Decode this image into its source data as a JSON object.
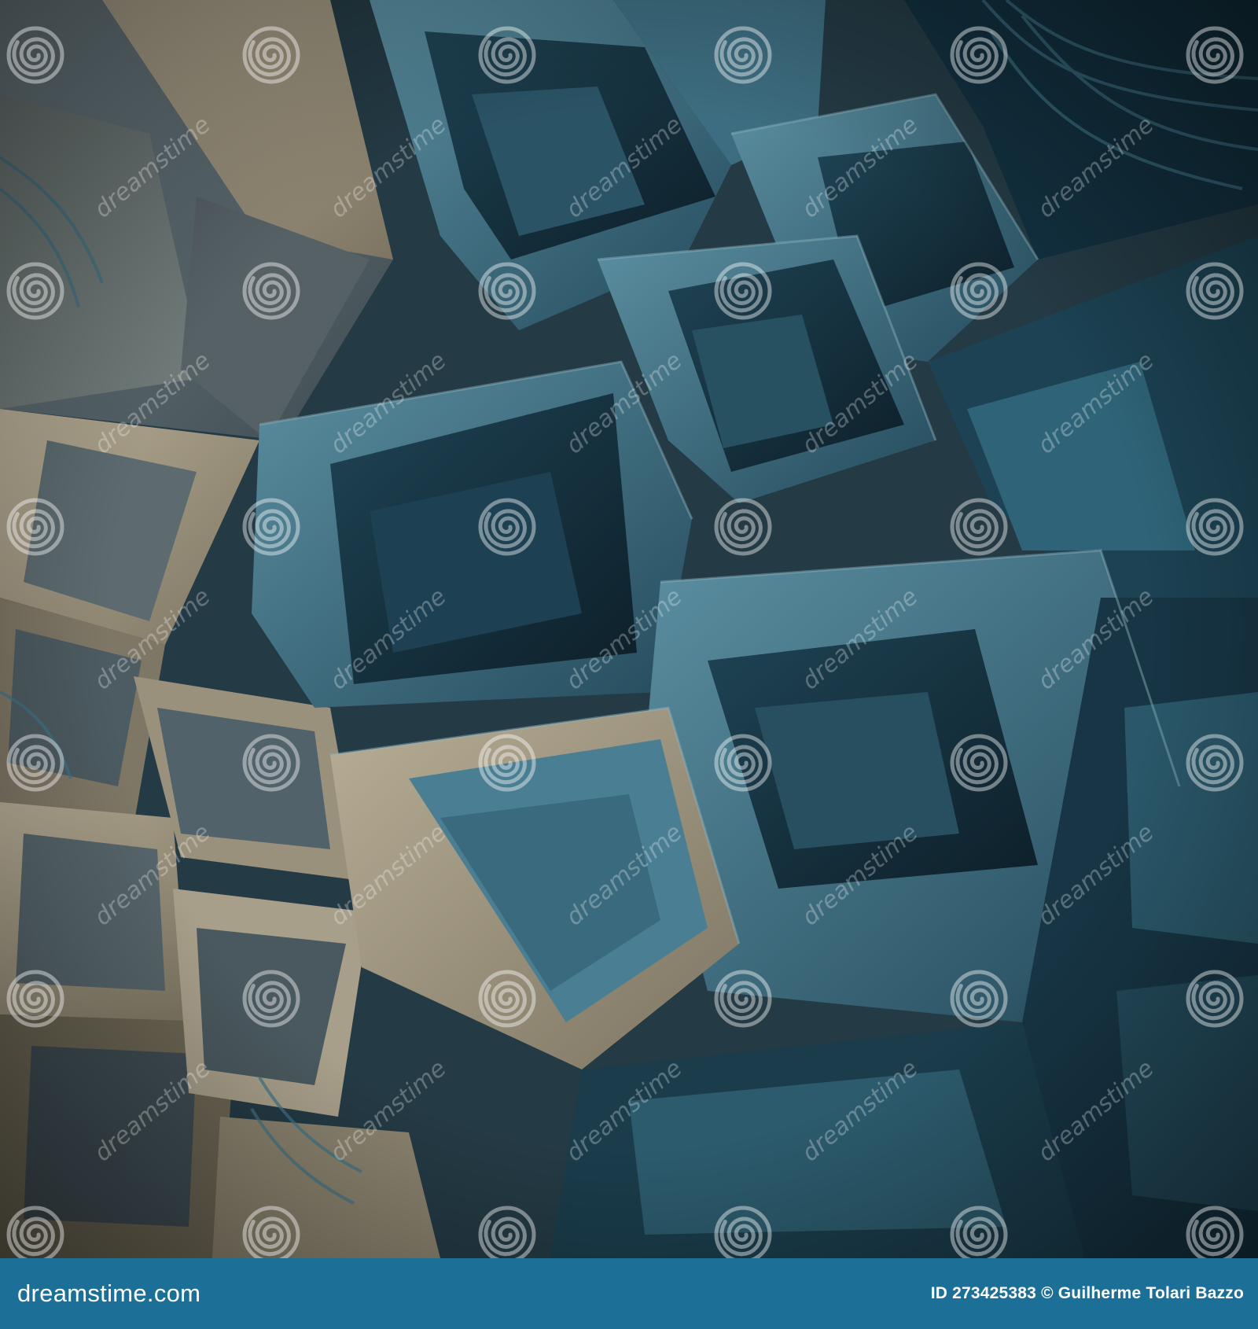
{
  "image": {
    "subject": "abstract 3D geometric relief",
    "palette": {
      "background_dark": "#0f1c24",
      "teal_blue": "#2f6478",
      "steel_blue": "#4a7f93",
      "deep_teal": "#173545",
      "beige": "#a89f8a",
      "sand": "#8f8672",
      "slate": "#5b6a70"
    }
  },
  "watermark": {
    "word": "dreamstime",
    "icon": "spiral-logo-icon"
  },
  "footer": {
    "brand": "dreamstime.com",
    "credit": "ID 273425383 © Guilherme Tolari Bazzo",
    "background": "#1c6f97"
  }
}
